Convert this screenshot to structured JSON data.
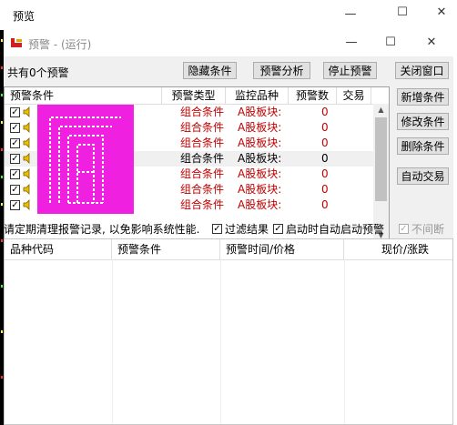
{
  "outer_window": {
    "title": "预览",
    "minimize": "—",
    "maximize": "☐",
    "close": "✕"
  },
  "inner_window": {
    "title": "预警 - (运行)",
    "minimize": "—",
    "maximize": "☐",
    "close": "✕"
  },
  "toolbar": {
    "count_text": "共有0个预警",
    "hide_conditions": "隐藏条件",
    "alert_analysis": "预警分析",
    "stop_alert": "停止预警",
    "close_window": "关闭窗口"
  },
  "side_buttons": {
    "add": "新增条件",
    "edit": "修改条件",
    "delete": "删除条件",
    "auto_trade": "自动交易"
  },
  "alert_table": {
    "columns": [
      "预警条件",
      "预警类型",
      "监控品种",
      "预警数",
      "交易"
    ],
    "rows": [
      {
        "type": "组合条件",
        "product": "A股板块:",
        "count": "0",
        "red": true
      },
      {
        "type": "组合条件",
        "product": "A股板块:",
        "count": "0",
        "red": true
      },
      {
        "type": "组合条件",
        "product": "A股板块:",
        "count": "0",
        "red": true
      },
      {
        "type": "组合条件",
        "product": "A股板块:",
        "count": "0",
        "red": false
      },
      {
        "type": "组合条件",
        "product": "A股板块:",
        "count": "0",
        "red": true
      },
      {
        "type": "组合条件",
        "product": "A股板块:",
        "count": "0",
        "red": true
      },
      {
        "type": "组合条件",
        "product": "A股板块:",
        "count": "0",
        "red": true
      }
    ]
  },
  "status_bar": {
    "notice": "请定期清理报警记录, 以免影响系统性能.",
    "filter_results": "过滤结果",
    "auto_start": "启动时自动启动预警",
    "no_interrupt": "不间断"
  },
  "record_table": {
    "columns": [
      "品种代码",
      "预警条件",
      "预警时间/价格",
      "现价/涨跌"
    ]
  },
  "colors": {
    "accent_red": "#c00000",
    "logo_magenta": "#f020e0"
  }
}
